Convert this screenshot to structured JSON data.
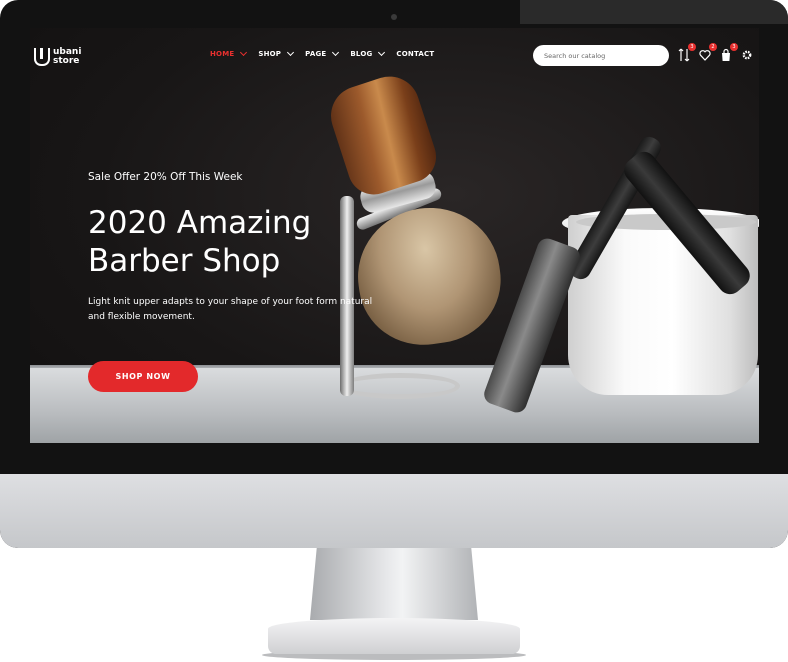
{
  "header": {
    "logo": {
      "line1": "ubani",
      "line2": "store"
    },
    "nav": [
      {
        "label": "HOME",
        "active": true,
        "has_dropdown": true
      },
      {
        "label": "SHOP",
        "active": false,
        "has_dropdown": true
      },
      {
        "label": "PAGE",
        "active": false,
        "has_dropdown": true
      },
      {
        "label": "BLOG",
        "active": false,
        "has_dropdown": true
      },
      {
        "label": "CONTACT",
        "active": false,
        "has_dropdown": false
      }
    ],
    "search": {
      "placeholder": "Search our catalog",
      "value": ""
    },
    "icons": [
      {
        "name": "compare-icon",
        "badge": "3"
      },
      {
        "name": "wishlist-heart-icon",
        "badge": "2"
      },
      {
        "name": "cart-bag-icon",
        "badge": "3"
      },
      {
        "name": "settings-gear-icon",
        "badge": ""
      }
    ]
  },
  "hero": {
    "subtitle": "Sale Offer 20% Off This Week",
    "title_line1": "2020 Amazing",
    "title_line2": "Barber Shop",
    "description": "Light knit upper adapts to your shape of your foot form natural and flexible movement.",
    "button_label": "SHOP NOW"
  },
  "colors": {
    "accent": "#e3292b",
    "background": "#171515",
    "text": "#ffffff"
  }
}
